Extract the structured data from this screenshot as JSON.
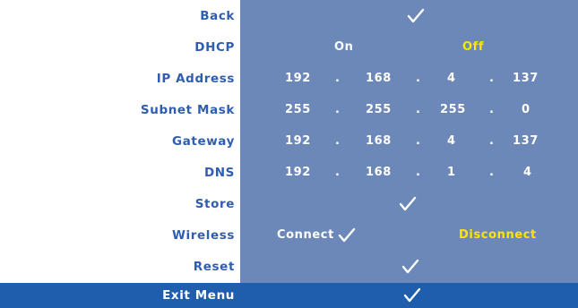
{
  "menu": {
    "back": {
      "label": "Back"
    },
    "dhcp": {
      "label": "DHCP",
      "on": "On",
      "off": "Off"
    },
    "ip_address": {
      "label": "IP Address",
      "octets": [
        "192",
        "168",
        "4",
        "137"
      ]
    },
    "subnet_mask": {
      "label": "Subnet Mask",
      "octets": [
        "255",
        "255",
        "255",
        "0"
      ]
    },
    "gateway": {
      "label": "Gateway",
      "octets": [
        "192",
        "168",
        "4",
        "137"
      ]
    },
    "dns": {
      "label": "DNS",
      "octets": [
        "192",
        "168",
        "1",
        "4"
      ]
    },
    "store": {
      "label": "Store"
    },
    "wireless": {
      "label": "Wireless",
      "connect": "Connect",
      "disconnect": "Disconnect"
    },
    "reset": {
      "label": "Reset"
    },
    "exit": {
      "label": "Exit Menu"
    },
    "separator": "."
  },
  "colors": {
    "panel": "#6b88b8",
    "label_text": "#2f5db0",
    "highlight_bar": "#1f5dad",
    "selected_text": "#ffe600",
    "value_text": "#ffffff"
  },
  "icons": {
    "check": "checkmark-icon"
  }
}
